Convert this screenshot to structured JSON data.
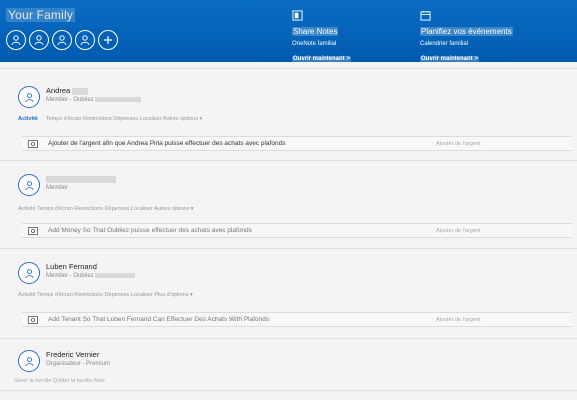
{
  "header": {
    "title": "Your Family",
    "add_icon": "plus-icon",
    "promos": [
      {
        "icon": "onenote-icon",
        "title": "Share Notes",
        "subtitle": "OneNote familial",
        "link": "Ouvrir maintenant >"
      },
      {
        "icon": "calendar-icon",
        "title": "Planifiez vos événements",
        "subtitle": "Calendrier familial",
        "link": "Ouvrir maintenant >"
      }
    ]
  },
  "members": [
    {
      "name": "Andrea",
      "role": "Member - Oubliez",
      "tabs": {
        "active": "Activité",
        "rest": "Temps d'écran  Restrictions  Dépenses  Localiser  Autres options ▾"
      },
      "activity": {
        "text": "Ajouter de l'argent afin que Andrea Pirla puisse effectuer des achats avec plafonds",
        "aside": "Ajouter de l'argent"
      }
    },
    {
      "name": "",
      "role": "Member",
      "tabs": {
        "active": "",
        "rest": "Activité  Temps d'écran  Restrictions  Dépenses  Localiser  Autres options  ▾"
      },
      "activity": {
        "text": "Add Money So That Oubliez puisse effectuer des achats avec plafonds",
        "aside": "Ajouter de l'argent"
      }
    },
    {
      "name": "Luben Fernand",
      "role": "Member - Oubliez",
      "tabs": {
        "active": "",
        "rest": "Activité  Temps d'écran  Restrictions  Dépenses  Localiser  Plus d'options  ▾"
      },
      "activity": {
        "text": "Add Tenant So That Luben Fernand Can Effectuer Des Achats With Plafonds",
        "aside": "Ajouter de l'argent"
      }
    },
    {
      "name": "Frederic Vernier",
      "role": "Organisateur - Premium",
      "tabs": {
        "active": "",
        "rest": "Gérer la famille  Quitter la famille  Aide"
      },
      "activity": null
    }
  ]
}
